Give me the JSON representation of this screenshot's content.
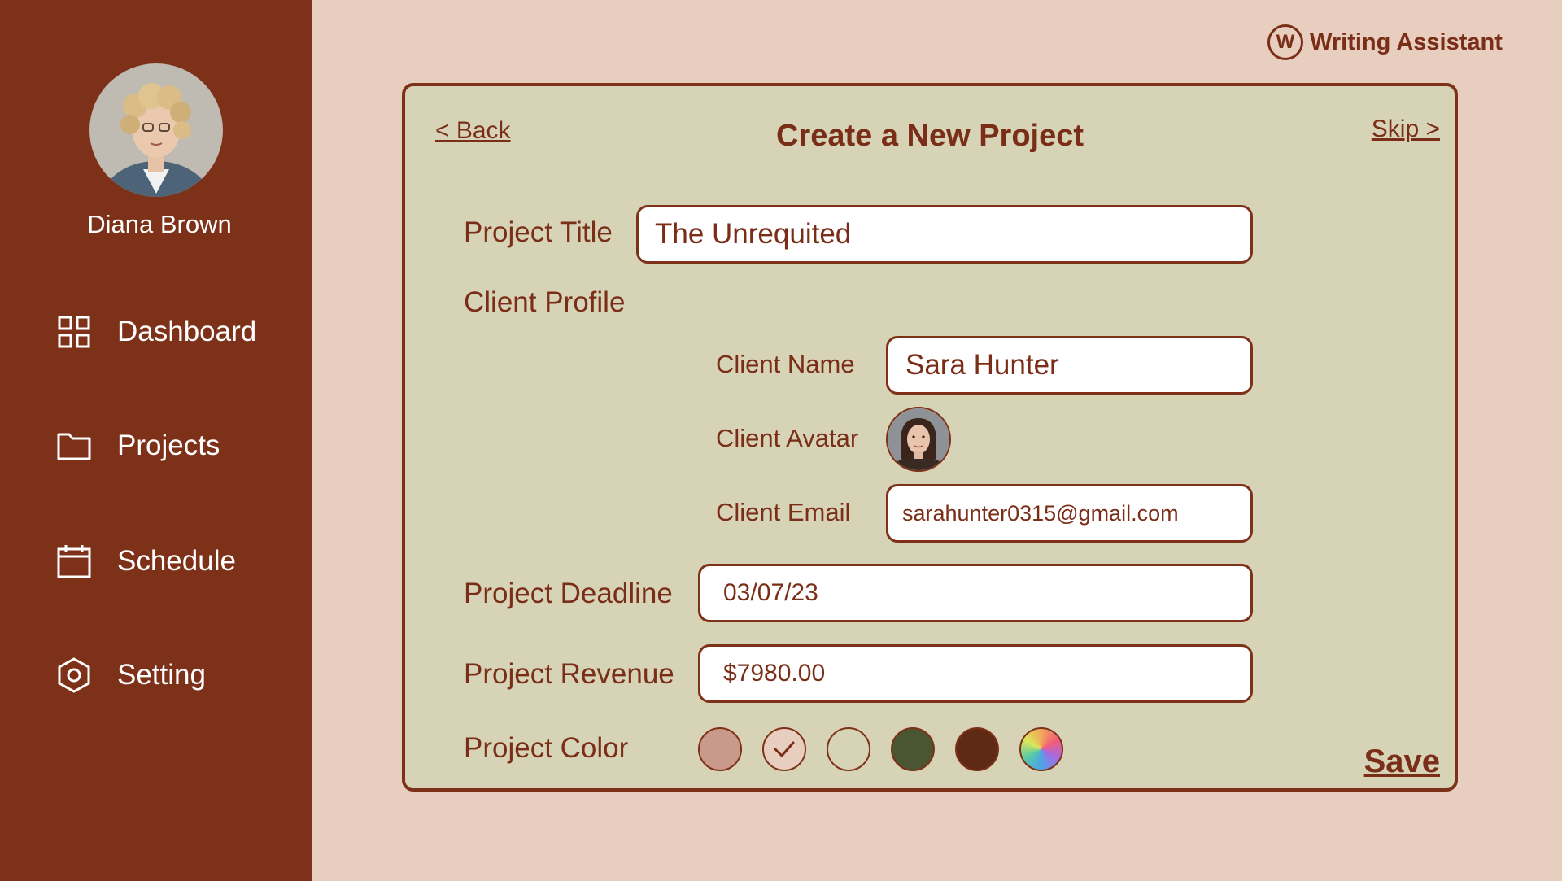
{
  "app": {
    "brand_letter": "W",
    "brand_name": "Writing Assistant"
  },
  "user": {
    "name": "Diana Brown"
  },
  "sidebar": {
    "items": [
      {
        "label": "Dashboard",
        "icon": "grid-icon"
      },
      {
        "label": "Projects",
        "icon": "folder-icon"
      },
      {
        "label": "Schedule",
        "icon": "calendar-icon"
      },
      {
        "label": "Setting",
        "icon": "gear-hexagon-icon"
      }
    ]
  },
  "card": {
    "title": "Create a New Project",
    "back_label": "< Back",
    "skip_label": "Skip >",
    "save_label": "Save"
  },
  "form": {
    "project_title_label": "Project Title",
    "project_title_value": "The Unrequited",
    "client_profile_label": "Client Profile",
    "client_name_label": "Client Name",
    "client_name_value": "Sara Hunter",
    "client_avatar_label": "Client Avatar",
    "client_email_label": "Client Email",
    "client_email_value": "sarahunter0315@gmail.com",
    "deadline_label": "Project Deadline",
    "deadline_value": "03/07/23",
    "revenue_label": "Project Revenue",
    "revenue_value": "$7980.00",
    "color_label": "Project Color",
    "colors": [
      {
        "name": "dusty-rose",
        "hex": "#C99A8B",
        "selected": false
      },
      {
        "name": "blush",
        "hex": "#E8CEBF",
        "selected": true
      },
      {
        "name": "sand",
        "hex": "#D7D3B6",
        "selected": false
      },
      {
        "name": "olive",
        "hex": "#4A5531",
        "selected": false
      },
      {
        "name": "brown",
        "hex": "#5E2A14",
        "selected": false
      },
      {
        "name": "rainbow",
        "hex": "multicolor",
        "selected": false
      }
    ]
  },
  "theme": {
    "sidebar_bg": "#7D3118",
    "page_bg": "#E8CEBF",
    "card_bg": "#D7D3B6",
    "accent": "#7A2E18"
  }
}
